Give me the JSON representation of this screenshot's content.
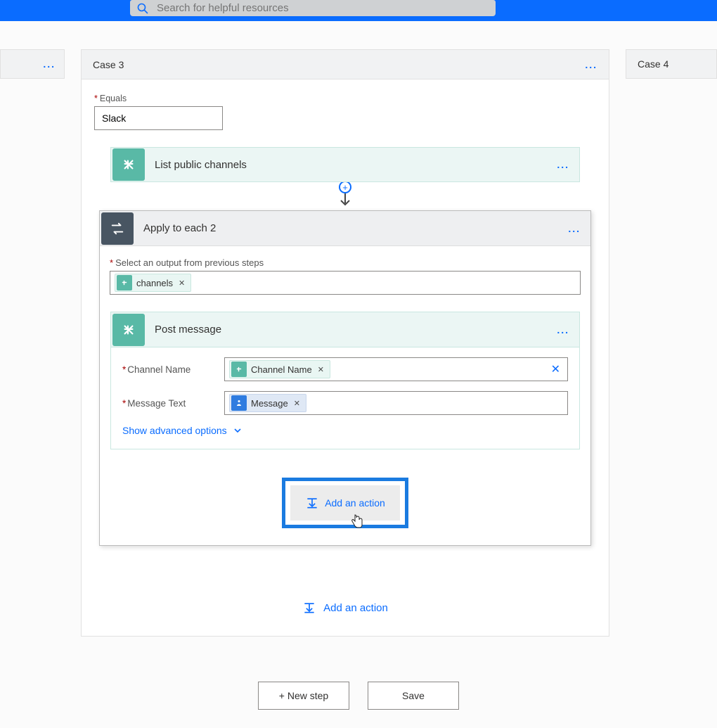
{
  "topbar": {
    "search_placeholder": "Search for helpful resources"
  },
  "cases": {
    "prev_stub": "...",
    "current_title": "Case 3",
    "current_menu": "...",
    "next_title": "Case 4"
  },
  "equals": {
    "label": "Equals",
    "value": "Slack"
  },
  "step_list_channels": {
    "title": "List public channels",
    "menu": "..."
  },
  "foreach": {
    "title": "Apply to each 2",
    "menu": "...",
    "select_output_label": "Select an output from previous steps",
    "output_token": "channels"
  },
  "post_message": {
    "title": "Post message",
    "menu": "...",
    "channel_label": "Channel Name",
    "channel_token": "Channel Name",
    "message_label": "Message Text",
    "message_token": "Message",
    "advanced": "Show advanced options"
  },
  "actions": {
    "add_action_inner": "Add an action",
    "add_action_outer": "Add an action",
    "new_step": "+ New step",
    "save": "Save"
  }
}
